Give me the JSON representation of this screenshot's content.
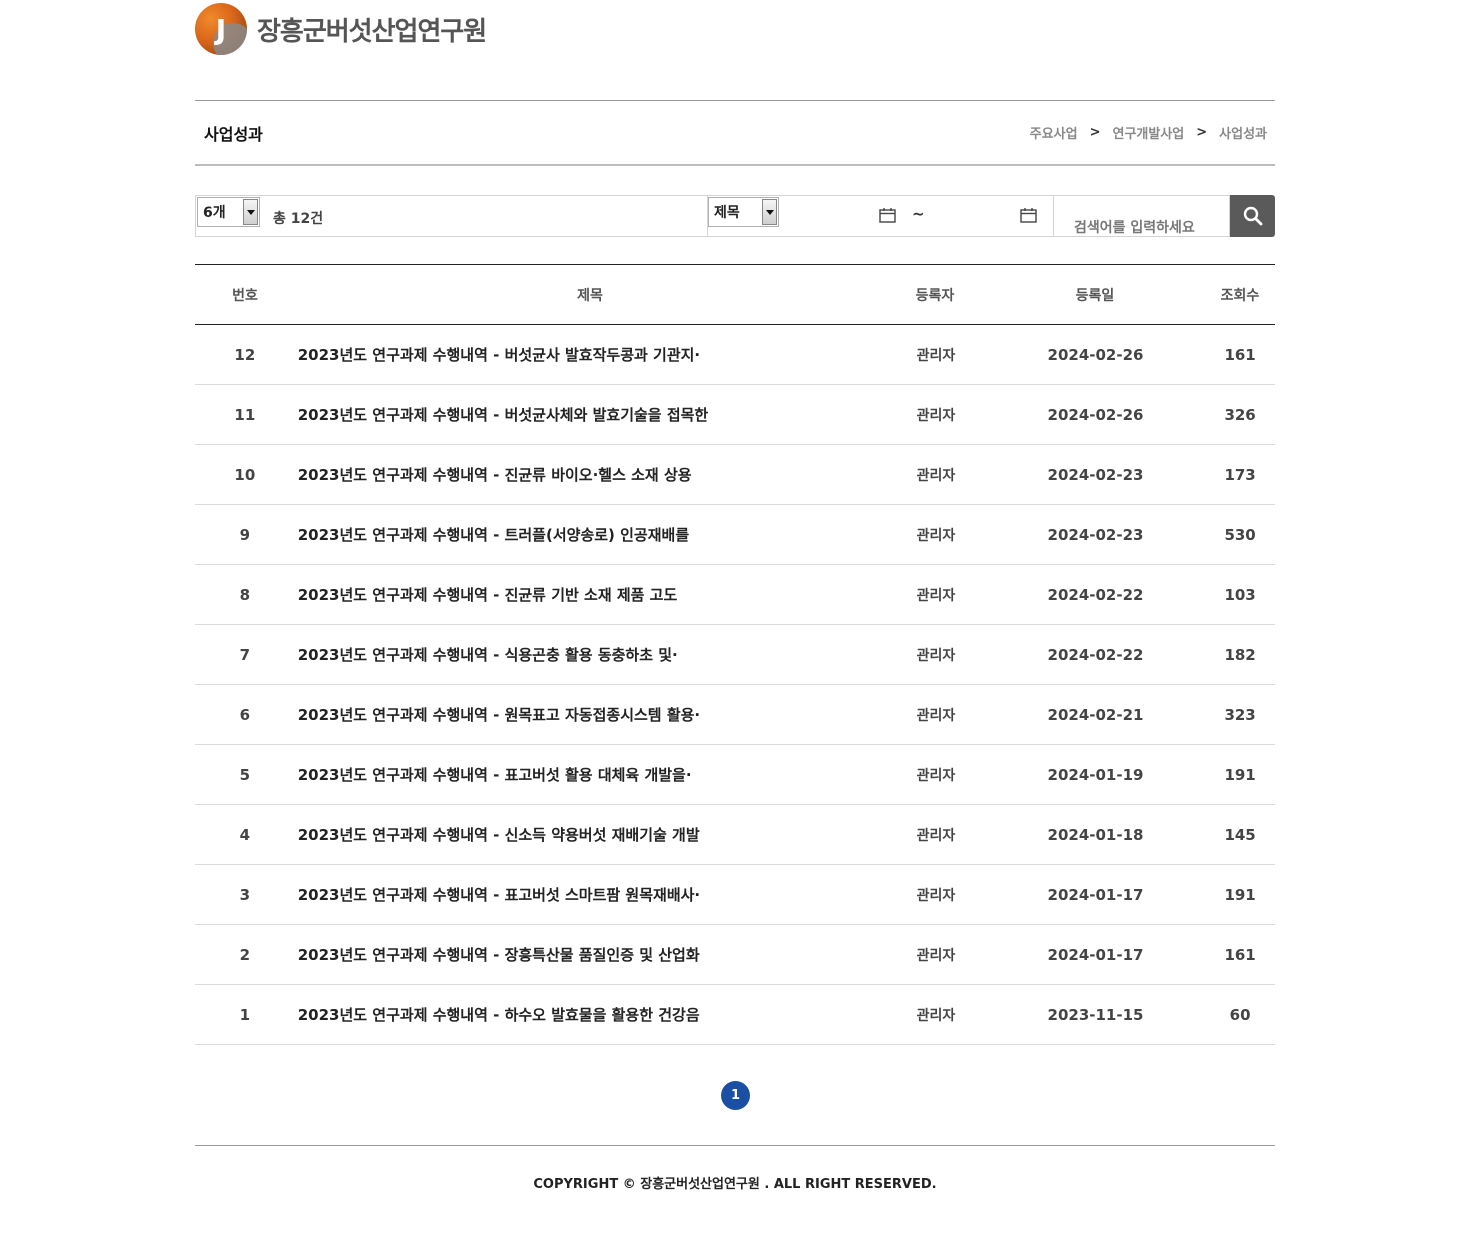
{
  "header": {
    "logo_letter": "J",
    "site_name": "장흥군버섯산업연구원",
    "colors": {
      "logo_orange": "#d9651a",
      "logo_gray": "#8a8a8a"
    }
  },
  "page": {
    "title": "사업성과",
    "breadcrumb": [
      "주요사업",
      "연구개발사업",
      "사업성과"
    ],
    "breadcrumb_separator": ">"
  },
  "search": {
    "page_size": "6개",
    "total_count": "총 12건",
    "field": "제목",
    "date_separator": "~",
    "placeholder": "검색어를 입력하세요",
    "icons": {
      "calendar_start": "calendar-icon",
      "calendar_end": "calendar-icon",
      "search": "search-icon"
    },
    "button_color": "#5a5a5a"
  },
  "table": {
    "columns": [
      "번호",
      "제목",
      "등록자",
      "등록일",
      "조회수"
    ],
    "rows": [
      {
        "no": "12",
        "title": "2023년도 연구과제 수행내역 - 버섯균사 발효작두콩과 기관지·",
        "author": "관리자",
        "date": "2024-02-26",
        "views": "161"
      },
      {
        "no": "11",
        "title": "2023년도 연구과제 수행내역 - 버섯균사체와 발효기술을 접목한",
        "author": "관리자",
        "date": "2024-02-26",
        "views": "326"
      },
      {
        "no": "10",
        "title": "2023년도 연구과제 수행내역 - 진균류 바이오·헬스 소재 상용",
        "author": "관리자",
        "date": "2024-02-23",
        "views": "173"
      },
      {
        "no": "9",
        "title": "2023년도 연구과제 수행내역 - 트러플(서양송로) 인공재배를",
        "author": "관리자",
        "date": "2024-02-23",
        "views": "530"
      },
      {
        "no": "8",
        "title": "2023년도 연구과제 수행내역 - 진균류 기반 소재 제품 고도",
        "author": "관리자",
        "date": "2024-02-22",
        "views": "103"
      },
      {
        "no": "7",
        "title": "2023년도 연구과제 수행내역 - 식용곤충 활용 동충하초 및·",
        "author": "관리자",
        "date": "2024-02-22",
        "views": "182"
      },
      {
        "no": "6",
        "title": "2023년도 연구과제 수행내역 - 원목표고 자동접종시스템 활용·",
        "author": "관리자",
        "date": "2024-02-21",
        "views": "323"
      },
      {
        "no": "5",
        "title": "2023년도 연구과제 수행내역 - 표고버섯 활용 대체육 개발을·",
        "author": "관리자",
        "date": "2024-01-19",
        "views": "191"
      },
      {
        "no": "4",
        "title": "2023년도 연구과제 수행내역 - 신소득 약용버섯 재배기술 개발",
        "author": "관리자",
        "date": "2024-01-18",
        "views": "145"
      },
      {
        "no": "3",
        "title": "2023년도 연구과제 수행내역 - 표고버섯 스마트팜 원목재배사·",
        "author": "관리자",
        "date": "2024-01-17",
        "views": "191"
      },
      {
        "no": "2",
        "title": "2023년도 연구과제 수행내역 - 장흥특산물 품질인증 및 산업화",
        "author": "관리자",
        "date": "2024-01-17",
        "views": "161"
      },
      {
        "no": "1",
        "title": "2023년도 연구과제 수행내역 - 하수오 발효물을 활용한 건강음",
        "author": "관리자",
        "date": "2023-11-15",
        "views": "60"
      }
    ]
  },
  "pagination": {
    "current_page": "1",
    "active_color": "#1a4fa3"
  },
  "footer": {
    "copyright": "COPYRIGHT © 장흥군버섯산업연구원 . ALL RIGHT RESERVED."
  }
}
